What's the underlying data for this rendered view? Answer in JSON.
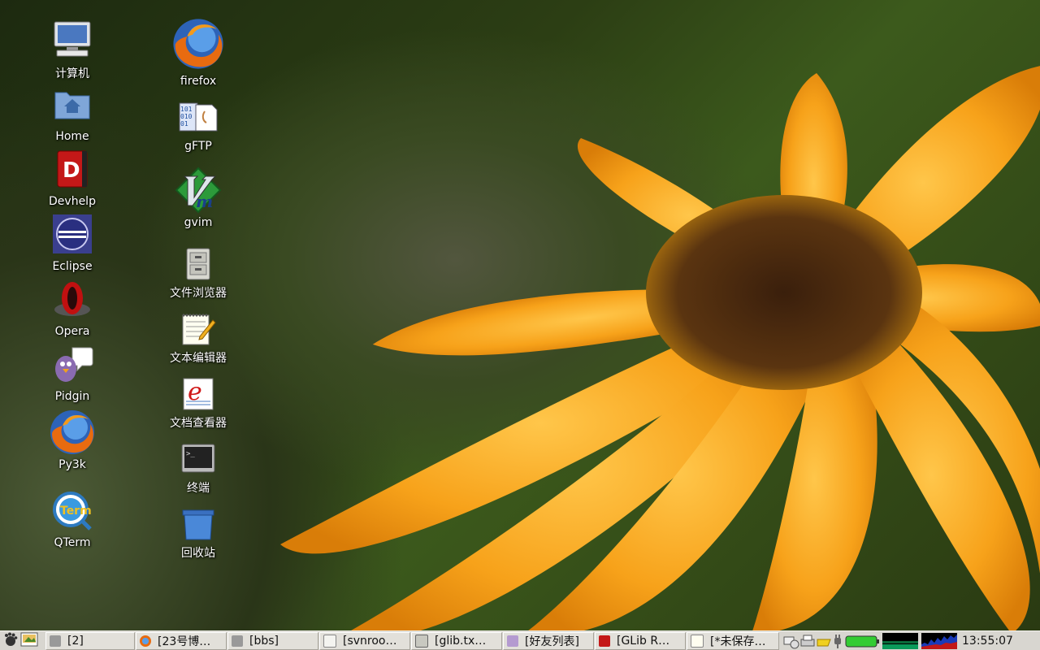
{
  "desktop_icons": {
    "col1": [
      {
        "label": "计算机",
        "icon": "computer-icon"
      },
      {
        "label": "Home",
        "icon": "home-folder-icon"
      },
      {
        "label": "Devhelp",
        "icon": "devhelp-icon"
      },
      {
        "label": "Eclipse",
        "icon": "eclipse-icon"
      },
      {
        "label": "Opera",
        "icon": "opera-icon"
      },
      {
        "label": "Pidgin",
        "icon": "pidgin-icon"
      },
      {
        "label": "Py3k",
        "icon": "firefox-icon"
      },
      {
        "label": "QTerm",
        "icon": "qterm-icon"
      }
    ],
    "col2": [
      {
        "label": "firefox",
        "icon": "firefox-icon"
      },
      {
        "label": "gFTP",
        "icon": "gftp-icon"
      },
      {
        "label": "gvim",
        "icon": "gvim-icon"
      },
      {
        "label": "文件浏览器",
        "icon": "file-cabinet-icon"
      },
      {
        "label": "文本编辑器",
        "icon": "text-editor-icon"
      },
      {
        "label": "文档查看器",
        "icon": "document-viewer-icon"
      },
      {
        "label": "终端",
        "icon": "terminal-icon"
      },
      {
        "label": "回收站",
        "icon": "trash-icon"
      }
    ]
  },
  "taskbar": {
    "tasks": [
      {
        "label": "[2]",
        "icon": "window-icon"
      },
      {
        "label": "[23号博…",
        "icon": "firefox-icon"
      },
      {
        "label": "[bbs]",
        "icon": "window-icon"
      },
      {
        "label": "[svnroo…",
        "icon": "document-icon"
      },
      {
        "label": "[glib.tx…",
        "icon": "tools-icon"
      },
      {
        "label": "[好友列表]",
        "icon": "pidgin-icon"
      },
      {
        "label": "[GLib R…",
        "icon": "devhelp-icon"
      },
      {
        "label": "[*未保存…",
        "icon": "text-editor-icon"
      }
    ],
    "clock": "13:55:07"
  },
  "colors": {
    "taskbar_bg": "#d8d6d0",
    "petal": "#f5a31a",
    "battery": "#33cc33"
  }
}
